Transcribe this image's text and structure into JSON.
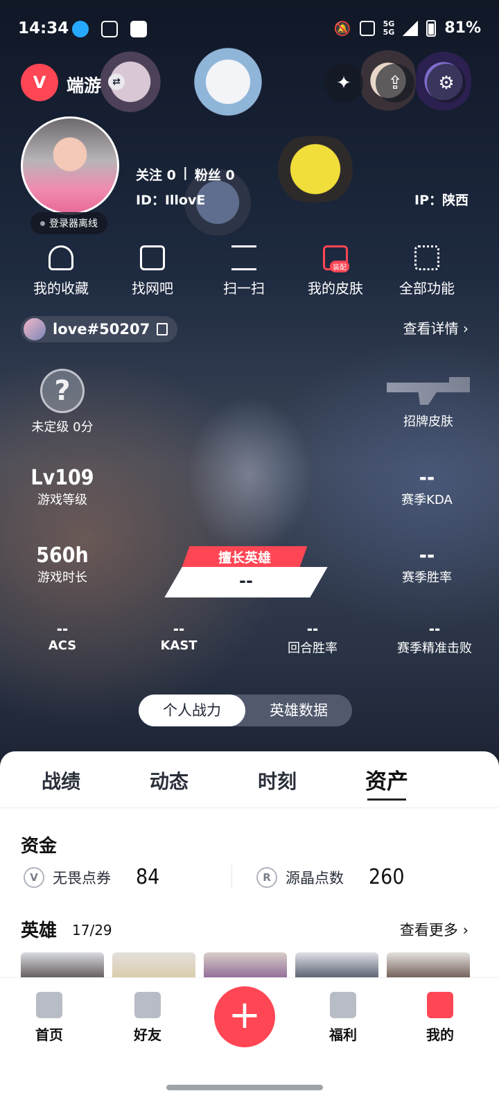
{
  "status_bar": {
    "time": "14:34",
    "network_top": "5G",
    "network_bottom": "5G",
    "battery": "81%"
  },
  "header": {
    "app_badge_text": "V",
    "app_name": "端游",
    "icons": [
      "switch-icon",
      "card-icon",
      "share-icon",
      "settings-icon"
    ]
  },
  "profile": {
    "login_status": "登录器离线",
    "follow_label": "关注",
    "follow_count": "0",
    "separator": "|",
    "fans_label": "粉丝",
    "fans_count": "0",
    "id_text": "ID：IllovE",
    "ip_text": "IP：陕西"
  },
  "actions": [
    {
      "label": "我的收藏",
      "icon": "heart-icon"
    },
    {
      "label": "找网吧",
      "icon": "monitor-icon"
    },
    {
      "label": "扫一扫",
      "icon": "scan-icon"
    },
    {
      "label": "我的皮肤",
      "icon": "skin-icon",
      "badge": "装配"
    },
    {
      "label": "全部功能",
      "icon": "grid-icon"
    }
  ],
  "player_tag": {
    "name": "love#50207",
    "detail_link": "查看详情 ›"
  },
  "stats": {
    "rank_symbol": "?",
    "rank_label": "未定级 0分",
    "signature_skin_label": "招牌皮肤",
    "level_value": "Lv109",
    "level_label": "游戏等级",
    "kda_value": "--",
    "kda_label": "赛季KDA",
    "hours_value": "560h",
    "hours_label": "游戏时长",
    "winrate_value": "--",
    "winrate_label": "赛季胜率",
    "best_hero_label": "擅长英雄",
    "best_hero_value": "--",
    "acs_value": "--",
    "acs_label": "ACS",
    "kast_value": "--",
    "kast_label": "KAST",
    "round_win_value": "--",
    "round_win_label": "回合胜率",
    "precise_value": "--",
    "precise_label": "赛季精准击败"
  },
  "segment": {
    "active": "个人战力",
    "inactive": "英雄数据"
  },
  "tabs": [
    "战绩",
    "动态",
    "时刻",
    "资产"
  ],
  "active_tab": "资产",
  "assets": {
    "section_funds": "资金",
    "vp_icon": "V",
    "vp_label": "无畏点券",
    "vp_value": "84",
    "rp_icon": "R",
    "rp_label": "源晶点数",
    "rp_value": "260",
    "section_heroes": "英雄",
    "hero_count": "17/29",
    "more_link": "查看更多 ›"
  },
  "bottom_nav": [
    {
      "label": "首页",
      "icon": "home-icon"
    },
    {
      "label": "好友",
      "icon": "friends-icon"
    },
    {
      "label": "福利",
      "icon": "gift-icon"
    },
    {
      "label": "我的",
      "icon": "profile-icon"
    }
  ],
  "colors": {
    "accent": "#ff4655",
    "sheet_bg": "#ffffff",
    "hero_bg": "#1e2a40"
  }
}
